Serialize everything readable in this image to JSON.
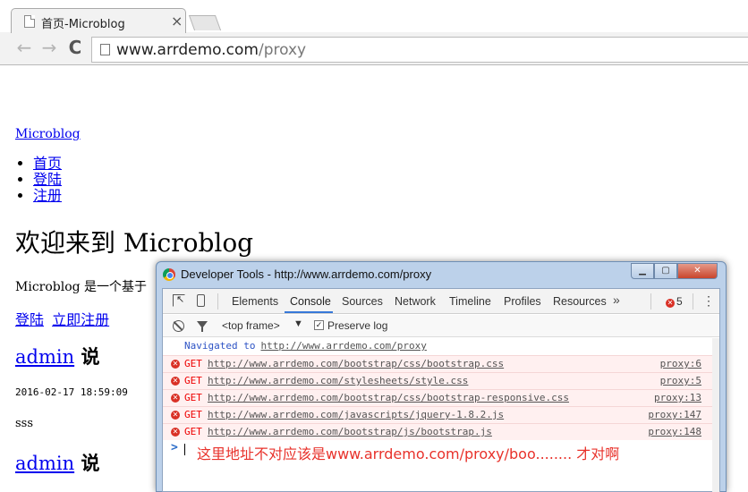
{
  "browser": {
    "tab_title": "首页-Microblog",
    "tab_close": "×",
    "url_host": "www.arrdemo.com",
    "url_path": "/proxy",
    "back": "←",
    "forward": "→",
    "reload": "C"
  },
  "page": {
    "brand": "Microblog",
    "nav": [
      "首页",
      "登陆",
      "注册"
    ],
    "headline": "欢迎来到 Microblog",
    "description": "Microblog 是一个基于",
    "login_link": "登陆",
    "register_link": "立即注册",
    "posts": [
      {
        "author": "admin",
        "says": "说",
        "timestamp": "2016-02-17 18:59:09",
        "content": "sss"
      },
      {
        "author": "admin",
        "says": "说"
      }
    ]
  },
  "devtools": {
    "title": "Developer Tools - http://www.arrdemo.com/proxy",
    "win_min": "▁",
    "win_max": "▢",
    "win_close": "✕",
    "tabs": [
      "Elements",
      "Console",
      "Sources",
      "Network",
      "Timeline",
      "Profiles",
      "Resources"
    ],
    "active_tab": "Console",
    "more_tabs": "»",
    "error_count": "5",
    "menu": "⋮",
    "frame_selector": "<top frame>",
    "frame_arrow": "▼",
    "preserve_log_label": "Preserve log",
    "preserve_log_checked": true,
    "navigated_label": "Navigated to",
    "navigated_url": "http://www.arrdemo.com/proxy",
    "errors": [
      {
        "method": "GET",
        "url": "http://www.arrdemo.com/bootstrap/css/bootstrap.css",
        "source": "proxy:6"
      },
      {
        "method": "GET",
        "url": "http://www.arrdemo.com/stylesheets/style.css",
        "source": "proxy:5"
      },
      {
        "method": "GET",
        "url": "http://www.arrdemo.com/bootstrap/css/bootstrap-responsive.css",
        "source": "proxy:13"
      },
      {
        "method": "GET",
        "url": "http://www.arrdemo.com/javascripts/jquery-1.8.2.js",
        "source": "proxy:147"
      },
      {
        "method": "GET",
        "url": "http://www.arrdemo.com/bootstrap/js/bootstrap.js",
        "source": "proxy:148"
      }
    ],
    "prompt": ">",
    "annotation": "这里地址不对应该是www.arrdemo.com/proxy/boo........ 才对啊",
    "colors": {
      "error": "#d93025",
      "annotation": "#e8322b",
      "active_tab": "#3879d9"
    }
  }
}
